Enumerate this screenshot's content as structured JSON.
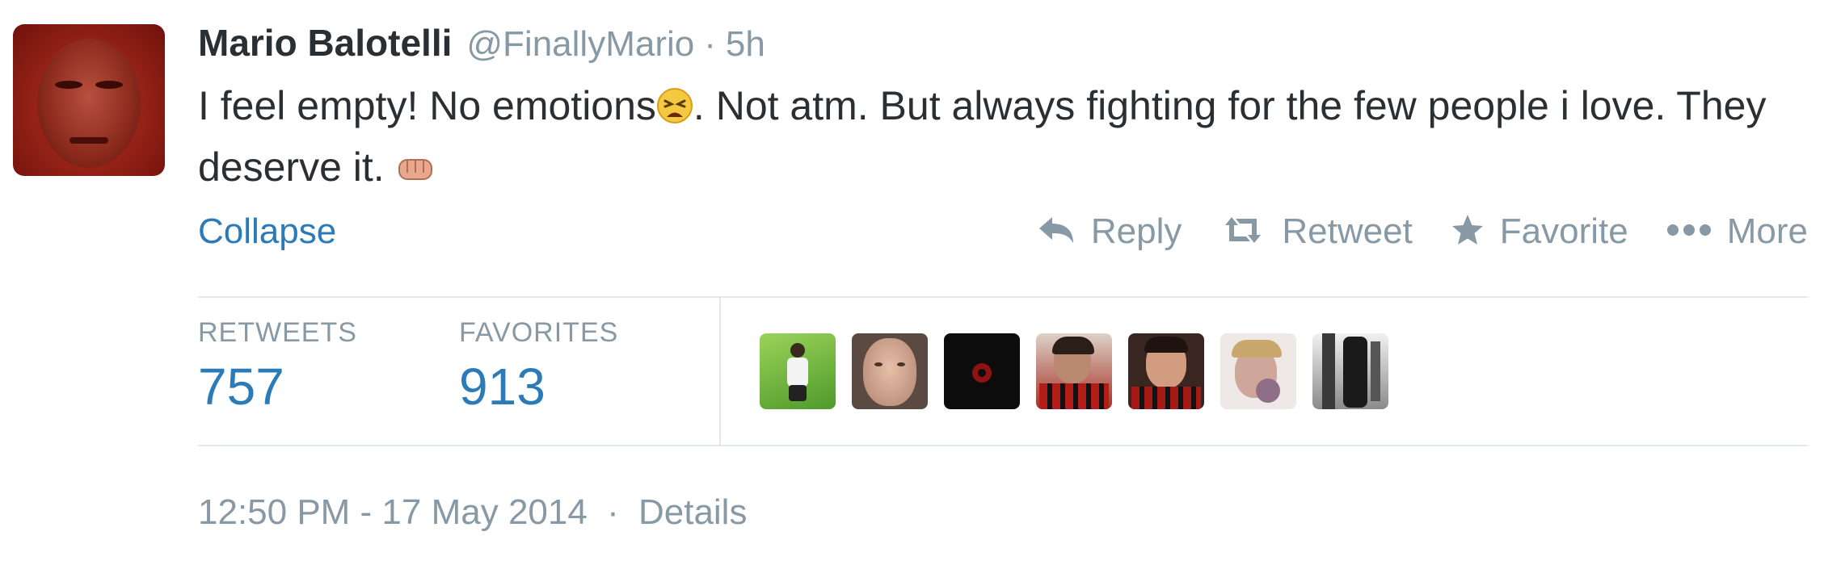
{
  "tweet": {
    "name": "Mario Balotelli",
    "handle": "@FinallyMario",
    "separator": "·",
    "age": "5h",
    "text_part1": "I feel empty! No emotions",
    "text_part2": ". Not atm. But always fighting for the few people i love. They deserve it.",
    "emoji_1": "tired-face-emoji",
    "emoji_2": "fist-emoji"
  },
  "collapse_label": "Collapse",
  "actions": {
    "reply": "Reply",
    "retweet": "Retweet",
    "favorite": "Favorite",
    "more": "More"
  },
  "stats": {
    "retweets_label": "RETWEETS",
    "retweets_count": "757",
    "favorites_label": "FAVORITES",
    "favorites_count": "913"
  },
  "footer": {
    "timestamp": "12:50 PM - 17 May 2014",
    "separator": "·",
    "details": "Details"
  },
  "colors": {
    "link": "#2b7bb9",
    "muted": "#8899a6",
    "text": "#292f33",
    "divider": "#e1e8ed"
  }
}
